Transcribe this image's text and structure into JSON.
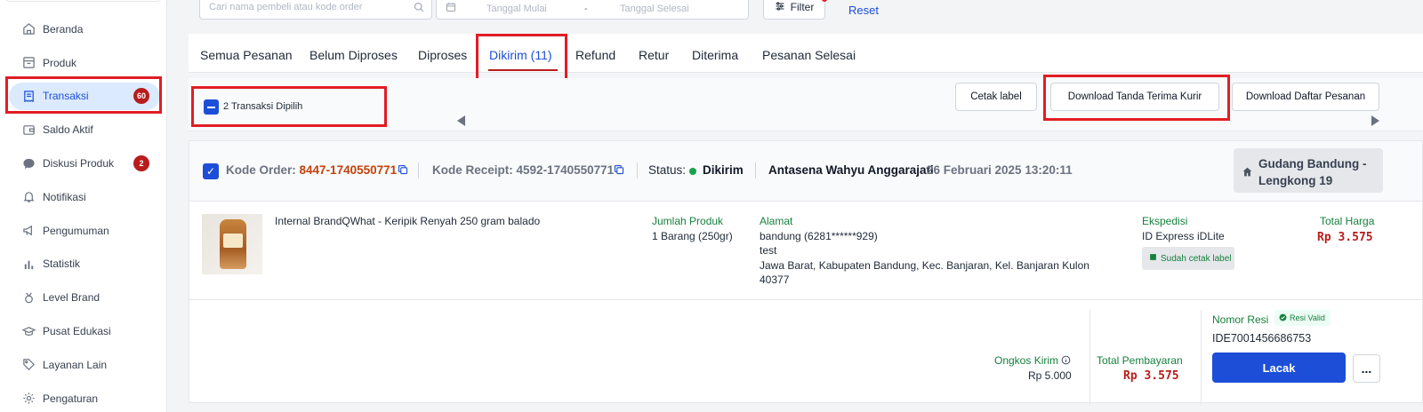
{
  "sidebar": {
    "items": [
      {
        "label": "Beranda",
        "icon": "home-icon"
      },
      {
        "label": "Produk",
        "icon": "box-icon"
      },
      {
        "label": "Transaksi",
        "icon": "receipt-icon",
        "badge": "60",
        "active": true
      },
      {
        "label": "Saldo Aktif",
        "icon": "wallet-icon"
      },
      {
        "label": "Diskusi Produk",
        "icon": "chat-icon",
        "badge": "2"
      },
      {
        "label": "Notifikasi",
        "icon": "bell-icon"
      },
      {
        "label": "Pengumuman",
        "icon": "megaphone-icon"
      },
      {
        "label": "Statistik",
        "icon": "bar-chart-icon"
      },
      {
        "label": "Level Brand",
        "icon": "medal-icon"
      },
      {
        "label": "Pusat Edukasi",
        "icon": "graduation-cap-icon"
      },
      {
        "label": "Layanan Lain",
        "icon": "tag-icon"
      },
      {
        "label": "Pengaturan",
        "icon": "gear-icon"
      }
    ]
  },
  "filters": {
    "search_placeholder": "Cari nama pembeli atau kode order",
    "date_start_placeholder": "Tanggal Mulai",
    "date_separator": "-",
    "date_end_placeholder": "Tanggal Selesai",
    "filter_label": "Filter",
    "reset_label": "Reset"
  },
  "tabs": [
    {
      "label": "Semua Pesanan"
    },
    {
      "label": "Belum Diproses"
    },
    {
      "label": "Diproses"
    },
    {
      "label": "Dikirim (11)",
      "active": true
    },
    {
      "label": "Refund"
    },
    {
      "label": "Retur"
    },
    {
      "label": "Diterima"
    },
    {
      "label": "Pesanan Selesai"
    }
  ],
  "bulk": {
    "selected_label": "2 Transaksi Dipilih",
    "cetak_label": "Cetak label",
    "download_tanda_terima": "Download Tanda Terima Kurir",
    "download_daftar": "Download Daftar Pesanan"
  },
  "order": {
    "kode_order_label": "Kode Order:",
    "kode_order": "8447-1740550771",
    "kode_receipt_label": "Kode Receipt:",
    "kode_receipt": "4592-1740550771",
    "status_label": "Status:",
    "status": "Dikirim",
    "buyer": "Antasena Wahyu Anggarajati",
    "date": "26 Februari 2025 13:20:11",
    "warehouse": "Gudang Bandung - Lengkong 19",
    "product_name": "Internal BrandQWhat - Keripik Renyah 250 gram balado",
    "jumlah_label": "Jumlah Produk",
    "jumlah": "1 Barang (250gr)",
    "alamat_label": "Alamat",
    "alamat_name": "bandung (6281******929)",
    "alamat_note": "test",
    "alamat_line1": "Jawa Barat, Kabupaten Bandung, Kec. Banjaran, Kel. Banjaran Kulon",
    "alamat_line2": "40377",
    "ekspedisi_label": "Ekspedisi",
    "ekspedisi": "ID Express iDLite",
    "cetak_status": "Sudah cetak label",
    "total_harga_label": "Total Harga",
    "total_harga": "Rp 3.575",
    "ongkos_label": "Ongkos Kirim",
    "ongkos": "Rp 5.000",
    "total_bayar_label": "Total Pembayaran",
    "total_bayar": "Rp 3.575",
    "resi_label": "Nomor Resi",
    "resi_valid": "Resi Valid",
    "resi": "IDE7001456686753",
    "lacak_label": "Lacak",
    "more_label": "..."
  },
  "colors": {
    "accent": "#1d4ed8",
    "highlight": "#e11d24",
    "price": "#b91c1c",
    "green": "#15803d"
  }
}
